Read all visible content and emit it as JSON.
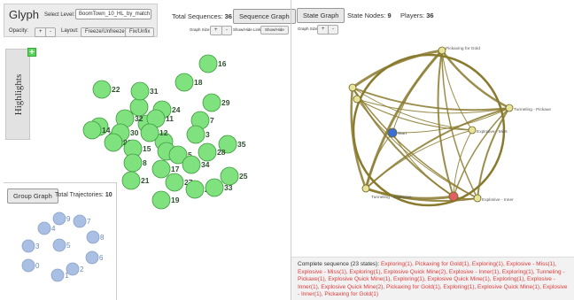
{
  "app": {
    "title": "Glyph",
    "level_label": "Select Level:",
    "level_value": "BoomTown_10_HL_by_match",
    "opacity_label": "Opacity:",
    "opacity_plus": "+",
    "opacity_minus": "-",
    "layout_label": "Layout:",
    "freeze_label": "Freeze/Unfreeze",
    "fix_label": "Fix/Unfix"
  },
  "sequence": {
    "total_label": "Total Sequences:",
    "total_value": "36",
    "graph_button": "Sequence Graph",
    "graph_size_label": "Graph Size",
    "plus": "+",
    "minus": "-",
    "showhide_label": "Show/Hide Links",
    "showhide_button": "Show/Hide"
  },
  "highlights": {
    "label": "Highlights",
    "toggle": "+"
  },
  "sequence_nodes": [
    {
      "id": "16",
      "col": "#7fe27f"
    },
    {
      "id": "18",
      "col": "#7fe27f"
    },
    {
      "id": "22",
      "col": "#7fe27f"
    },
    {
      "id": "31",
      "col": "#7fe27f"
    },
    {
      "id": "29",
      "col": "#7fe27f"
    },
    {
      "id": "24",
      "col": "#7fe27f"
    },
    {
      "id": "32",
      "col": "#7fe27f"
    },
    {
      "id": "11",
      "col": "#7fe27f"
    },
    {
      "id": "7",
      "col": "#7fe27f"
    },
    {
      "id": "14",
      "col": "#7fe27f"
    },
    {
      "id": "30",
      "col": "#7fe27f"
    },
    {
      "id": "12",
      "col": "#7fe27f"
    },
    {
      "id": "3",
      "col": "#7fe27f"
    },
    {
      "id": "23",
      "col": "#7fe27f"
    },
    {
      "id": "15",
      "col": "#7fe27f"
    },
    {
      "id": "35",
      "col": "#7fe27f"
    },
    {
      "id": "10",
      "col": "#7fe27f"
    },
    {
      "id": "5",
      "col": "#7fe27f"
    },
    {
      "id": "28",
      "col": "#7fe27f"
    },
    {
      "id": "8",
      "col": "#7fe27f"
    },
    {
      "id": "17",
      "col": "#7fe27f"
    },
    {
      "id": "34",
      "col": "#7fe27f"
    },
    {
      "id": "21",
      "col": "#7fe27f"
    },
    {
      "id": "27",
      "col": "#7fe27f"
    },
    {
      "id": "25",
      "col": "#7fe27f"
    },
    {
      "id": "26",
      "col": "#7fe27f"
    },
    {
      "id": "33",
      "col": "#7fe27f"
    },
    {
      "id": "19",
      "col": "#7fe27f"
    }
  ],
  "group": {
    "button": "Group Graph",
    "total_label": "Total Trajectories:",
    "total_value": "10",
    "nodes": [
      "9",
      "7",
      "4",
      "8",
      "3",
      "5",
      "6",
      "0",
      "2",
      "1"
    ]
  },
  "state": {
    "button": "State Graph",
    "nodes_label": "State Nodes:",
    "nodes_value": "9",
    "players_label": "Players:",
    "players_value": "36",
    "graph_size_label": "Graph Size",
    "plus": "+",
    "minus": "-",
    "node_labels": {
      "pickaxing": "Pickaxing for Gold",
      "tunneling": "Tunneling - Pickaxe",
      "miss": "Explosive - Miss",
      "start": "Start",
      "tunneling_explosive": "Tunneling - Explosive",
      "inner": "Explosive - Inner"
    },
    "edge_color": "#8a7a2e",
    "start_color": "#3b6fd8",
    "end_color": "#e06060"
  },
  "complete_sequence": {
    "label": "Complete sequence (23 states):",
    "text": "Exploring(1), Pickaxing for Gold(1), Exploring(1), Explosive - Miss(1), Explosive - Miss(1), Exploring(1), Explosive Quick Mine(2), Explosive - Inner(1), Exploring(1), Tunneling - Pickaxe(1), Explosive Quick Mine(1), Exploring(1), Explosive Quick Mine(1), Exploring(1), Explosive - Inner(1), Explosive Quick Mine(2), Pickaxing for Gold(1), Exploring(1), Explosive Quick Mine(1), Explosive - Inner(1), Pickaxing for Gold(1)"
  }
}
